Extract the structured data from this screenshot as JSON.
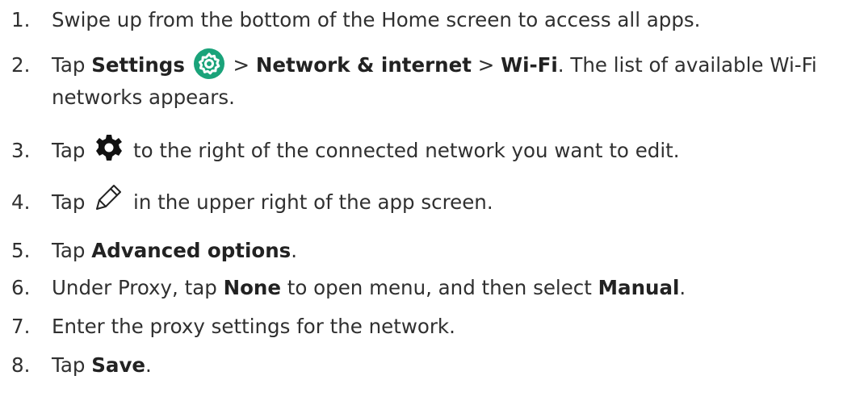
{
  "steps": [
    {
      "num": "1.",
      "text": "Swipe up from the bottom of the Home screen to access all apps."
    },
    {
      "num": "2.",
      "pre": "Tap ",
      "b1": "Settings",
      "sep1": " > ",
      "b2": "Network & internet",
      "sep2": " > ",
      "b3": "Wi-Fi",
      "post": ". The list of available Wi-Fi",
      "cont": "networks appears.",
      "icon": "settings-app-icon"
    },
    {
      "num": "3.",
      "pre": "Tap ",
      "post": " to the right of the connected network you want to edit.",
      "icon": "gear-icon"
    },
    {
      "num": "4.",
      "pre": "Tap ",
      "post": " in the upper right of the app screen.",
      "icon": "pencil-icon"
    },
    {
      "num": "5.",
      "pre": "Tap ",
      "b1": "Advanced options",
      "post": "."
    },
    {
      "num": "6.",
      "pre": "Under Proxy, tap ",
      "b1": "None",
      "mid": " to open menu, and then select ",
      "b2": "Manual",
      "post": "."
    },
    {
      "num": "7.",
      "text": "Enter the proxy settings for the network."
    },
    {
      "num": "8.",
      "pre": "Tap ",
      "b1": "Save",
      "post": "."
    }
  ],
  "colors": {
    "text": "#303030",
    "settings_icon_bg": "#1aa37a"
  }
}
